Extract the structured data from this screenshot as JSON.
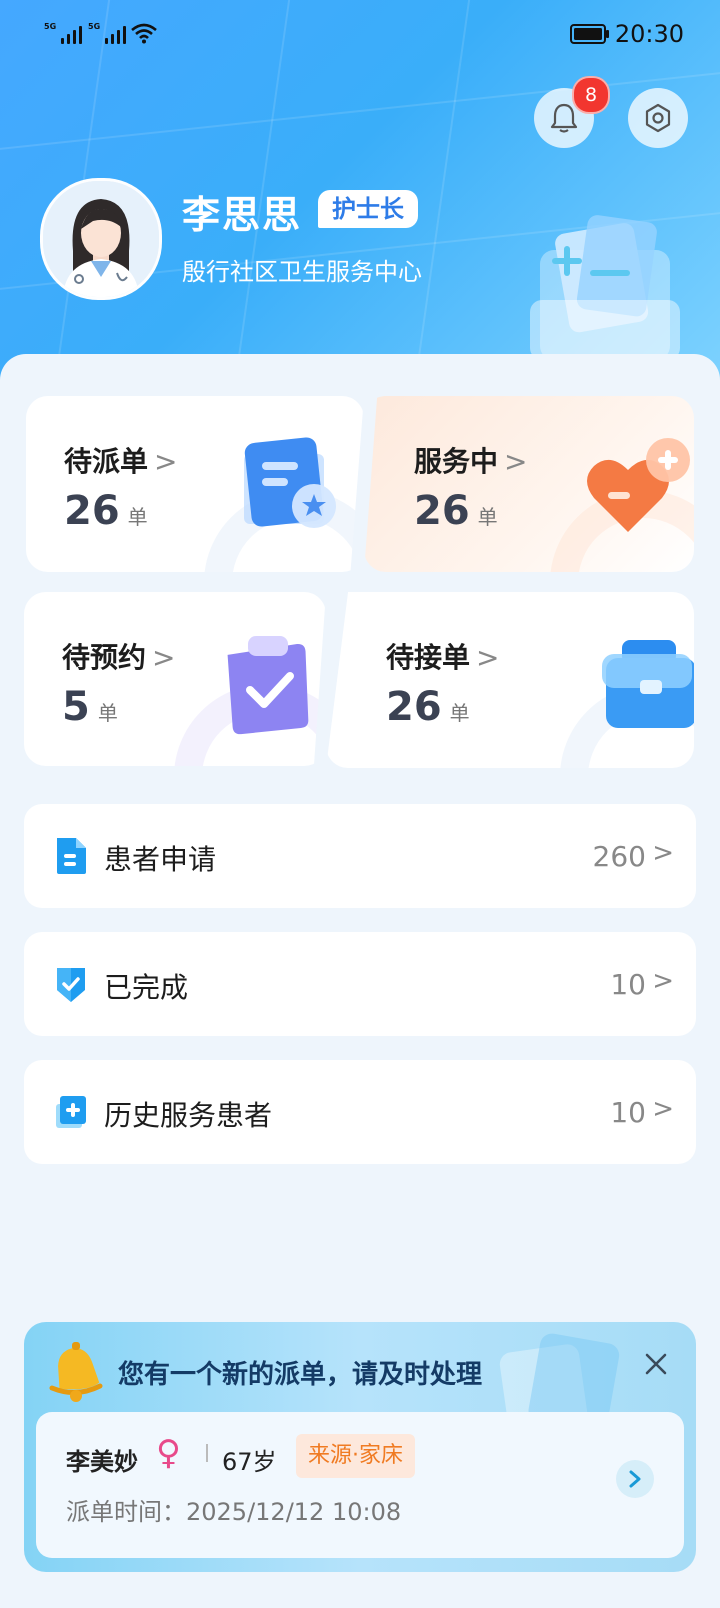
{
  "status_bar": {
    "time": "20:30",
    "signal1_label": "5G",
    "signal2_label": "5G"
  },
  "header": {
    "notification_count": "8",
    "user_name": "李思思",
    "role": "护士长",
    "organization": "殷行社区卫生服务中心"
  },
  "cards": [
    {
      "title": "待派单",
      "count": "26",
      "unit": "单"
    },
    {
      "title": "服务中",
      "count": "26",
      "unit": "单"
    },
    {
      "title": "待预约",
      "count": "5",
      "unit": "单"
    },
    {
      "title": "待接单",
      "count": "26",
      "unit": "单"
    }
  ],
  "card_chevron": ">",
  "list": [
    {
      "label": "患者申请",
      "count": "260",
      "icon": "document-icon"
    },
    {
      "label": "已完成",
      "count": "10",
      "icon": "shield-check-icon"
    },
    {
      "label": "历史服务患者",
      "count": "10",
      "icon": "medical-record-icon"
    }
  ],
  "list_chevron": ">",
  "notice": {
    "title": "您有一个新的派单，请及时处理",
    "patient_name": "李美妙",
    "gender_symbol": "♀",
    "age": "67岁",
    "source": "来源·家床",
    "dispatch_time": "派单时间：2025/12/12 10:08"
  },
  "colors": {
    "header_blue": "#3aaef9",
    "badge_red": "#f2362f",
    "role_text": "#2e7ce8",
    "source_orange": "#f07b22",
    "female_pink": "#e84a8a"
  }
}
